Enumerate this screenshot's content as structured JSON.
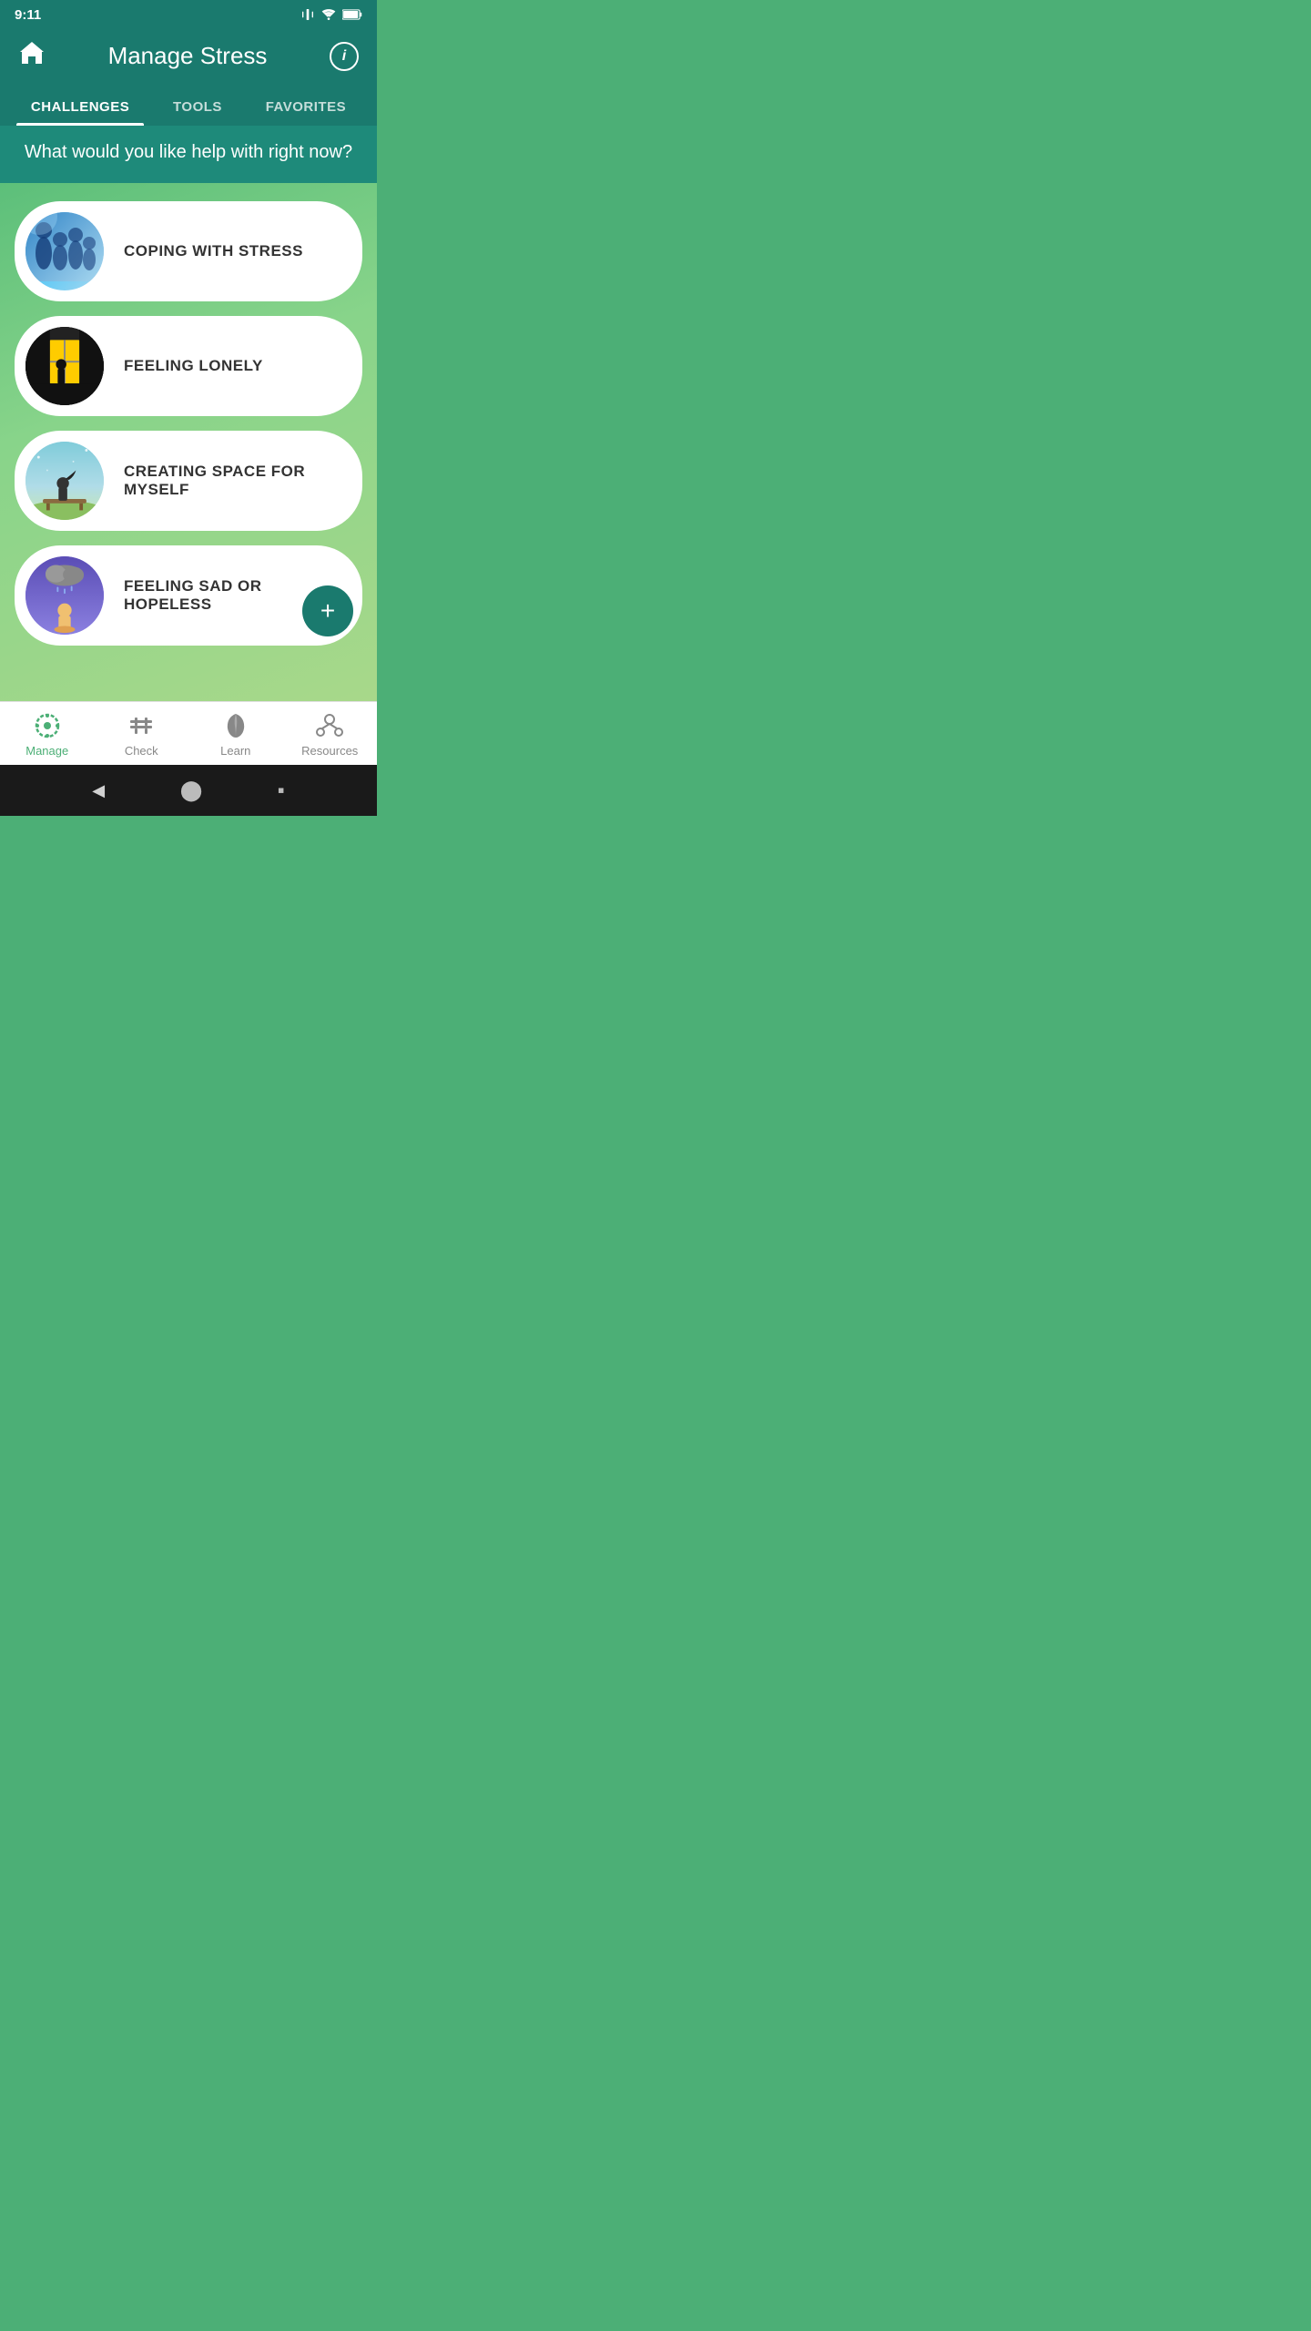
{
  "statusBar": {
    "time": "9:11"
  },
  "header": {
    "title": "Manage Stress",
    "homeIcon": "🏠",
    "infoLabel": "i"
  },
  "tabs": [
    {
      "id": "challenges",
      "label": "CHALLENGES",
      "active": true
    },
    {
      "id": "tools",
      "label": "TOOLS",
      "active": false
    },
    {
      "id": "favorites",
      "label": "FAVORITES",
      "active": false
    }
  ],
  "subtitle": "What would you like help with right now?",
  "challenges": [
    {
      "id": "coping",
      "label": "COPING WITH STRESS",
      "iconType": "coping"
    },
    {
      "id": "lonely",
      "label": "FEELING LONELY",
      "iconType": "lonely"
    },
    {
      "id": "space",
      "label": "CREATING SPACE FOR MYSELF",
      "iconType": "space"
    },
    {
      "id": "sad",
      "label": "FEELING SAD OR HOPELESS",
      "iconType": "sad"
    }
  ],
  "fab": {
    "label": "+"
  },
  "bottomNav": [
    {
      "id": "manage",
      "label": "Manage",
      "active": true
    },
    {
      "id": "check",
      "label": "Check",
      "active": false
    },
    {
      "id": "learn",
      "label": "Learn",
      "active": false
    },
    {
      "id": "resources",
      "label": "Resources",
      "active": false
    }
  ],
  "systemNav": {
    "back": "◀",
    "home": "⬤",
    "recent": "▪"
  }
}
